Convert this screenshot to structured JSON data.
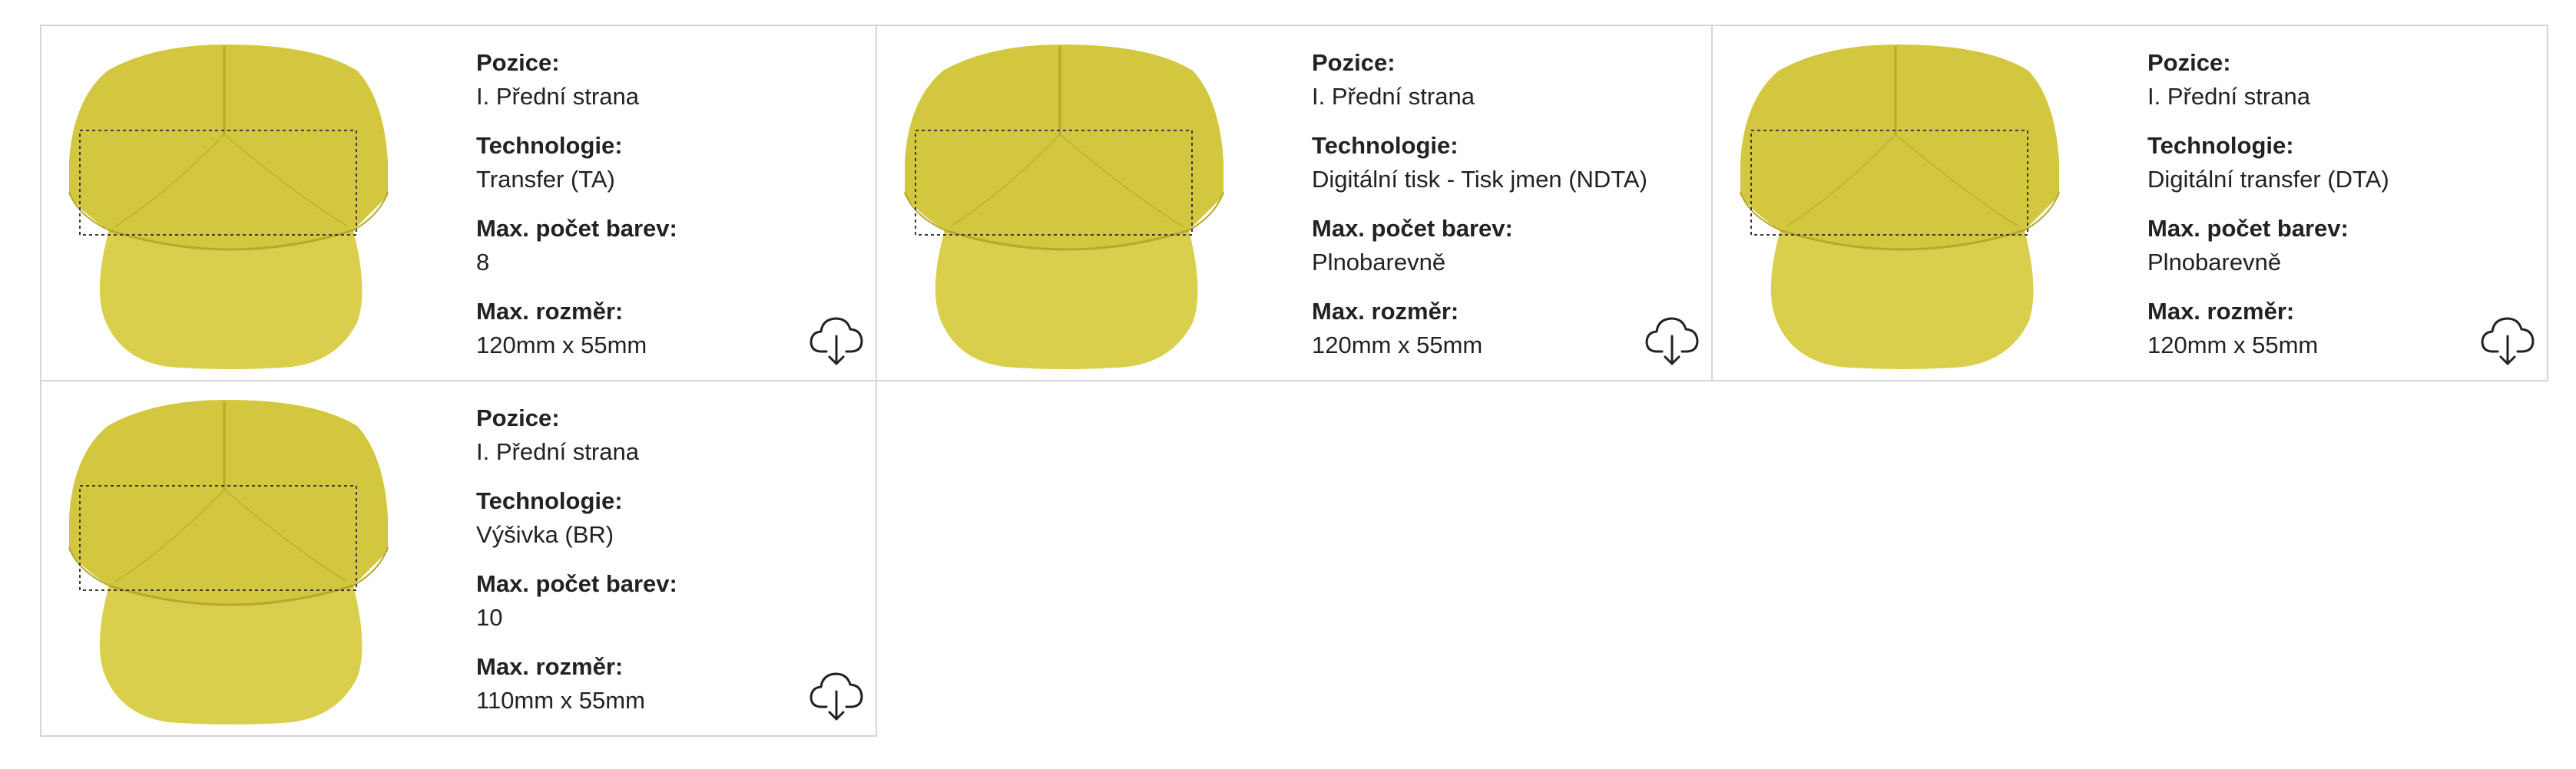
{
  "labels": {
    "position": "Pozice:",
    "technology": "Technologie:",
    "max_colors": "Max. počet barev:",
    "max_size": "Max. rozměr:"
  },
  "colors": {
    "cap_main": "#d3c73f",
    "cap_shadow": "#b5a82c",
    "cap_light": "#e0d65a",
    "border": "#d6d6d6"
  },
  "icons": {
    "download": "cloud-download-icon"
  },
  "cards": [
    {
      "position": "I. Přední strana",
      "technology": "Transfer (TA)",
      "max_colors": "8",
      "max_size": "120mm x 55mm"
    },
    {
      "position": "I. Přední strana",
      "technology": "Digitální tisk - Tisk jmen (NDTA)",
      "max_colors": "Plnobarevně",
      "max_size": "120mm x 55mm"
    },
    {
      "position": "I. Přední strana",
      "technology": "Digitální transfer (DTA)",
      "max_colors": "Plnobarevně",
      "max_size": "120mm x 55mm"
    },
    {
      "position": "I. Přední strana",
      "technology": "Výšivka (BR)",
      "max_colors": "10",
      "max_size": "110mm x 55mm"
    }
  ]
}
